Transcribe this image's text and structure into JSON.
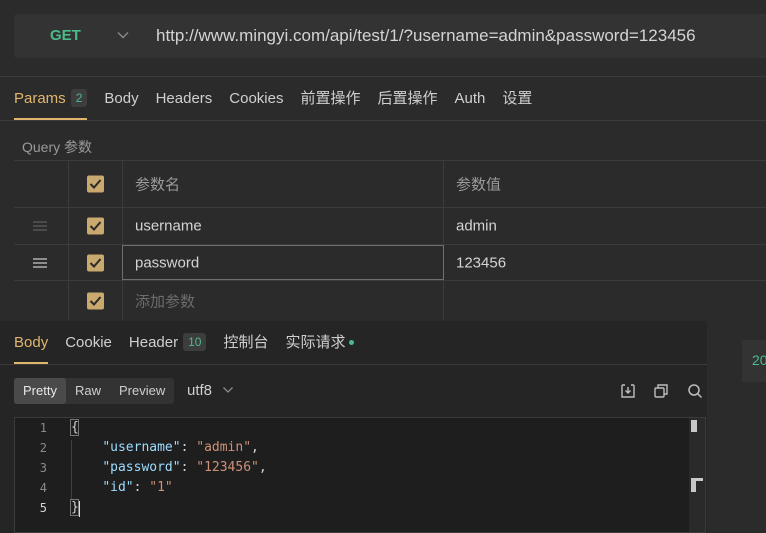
{
  "request": {
    "method": "GET",
    "url": "http://www.mingyi.com/api/test/1/?username=admin&password=123456"
  },
  "request_tabs": [
    {
      "label": "Params",
      "badge": "2",
      "active": true
    },
    {
      "label": "Body"
    },
    {
      "label": "Headers"
    },
    {
      "label": "Cookies"
    },
    {
      "label": "前置操作"
    },
    {
      "label": "后置操作"
    },
    {
      "label": "Auth"
    },
    {
      "label": "设置"
    }
  ],
  "params": {
    "section_label": "Query 参数",
    "header": {
      "name": "参数名",
      "value": "参数值"
    },
    "rows": [
      {
        "name": "username",
        "value": "admin",
        "checked": true
      },
      {
        "name": "password",
        "value": "123456",
        "checked": true
      }
    ],
    "add_placeholder": "添加参数"
  },
  "response_tabs": [
    {
      "label": "Body",
      "active": true
    },
    {
      "label": "Cookie"
    },
    {
      "label": "Header",
      "badge": "10"
    },
    {
      "label": "控制台"
    },
    {
      "label": "实际请求",
      "dot": true
    }
  ],
  "response": {
    "formats": [
      "Pretty",
      "Raw",
      "Preview"
    ],
    "active_format": "Pretty",
    "encoding": "utf8",
    "status_fragment": "20",
    "line_numbers": [
      "1",
      "2",
      "3",
      "4",
      "5"
    ],
    "body_lines": [
      {
        "text": "{"
      },
      {
        "key": "\"username\"",
        "value": "\"admin\"",
        "comma": true
      },
      {
        "key": "\"password\"",
        "value": "\"123456\"",
        "comma": true
      },
      {
        "key": "\"id\"",
        "value": "\"1\"",
        "comma": false
      },
      {
        "text": "}"
      }
    ]
  },
  "colors": {
    "accent": "#e0b56d",
    "method_green": "#4cba8b",
    "json_key": "#9cdcfe",
    "json_string": "#ce9178",
    "checkbox": "#c9a96e"
  }
}
